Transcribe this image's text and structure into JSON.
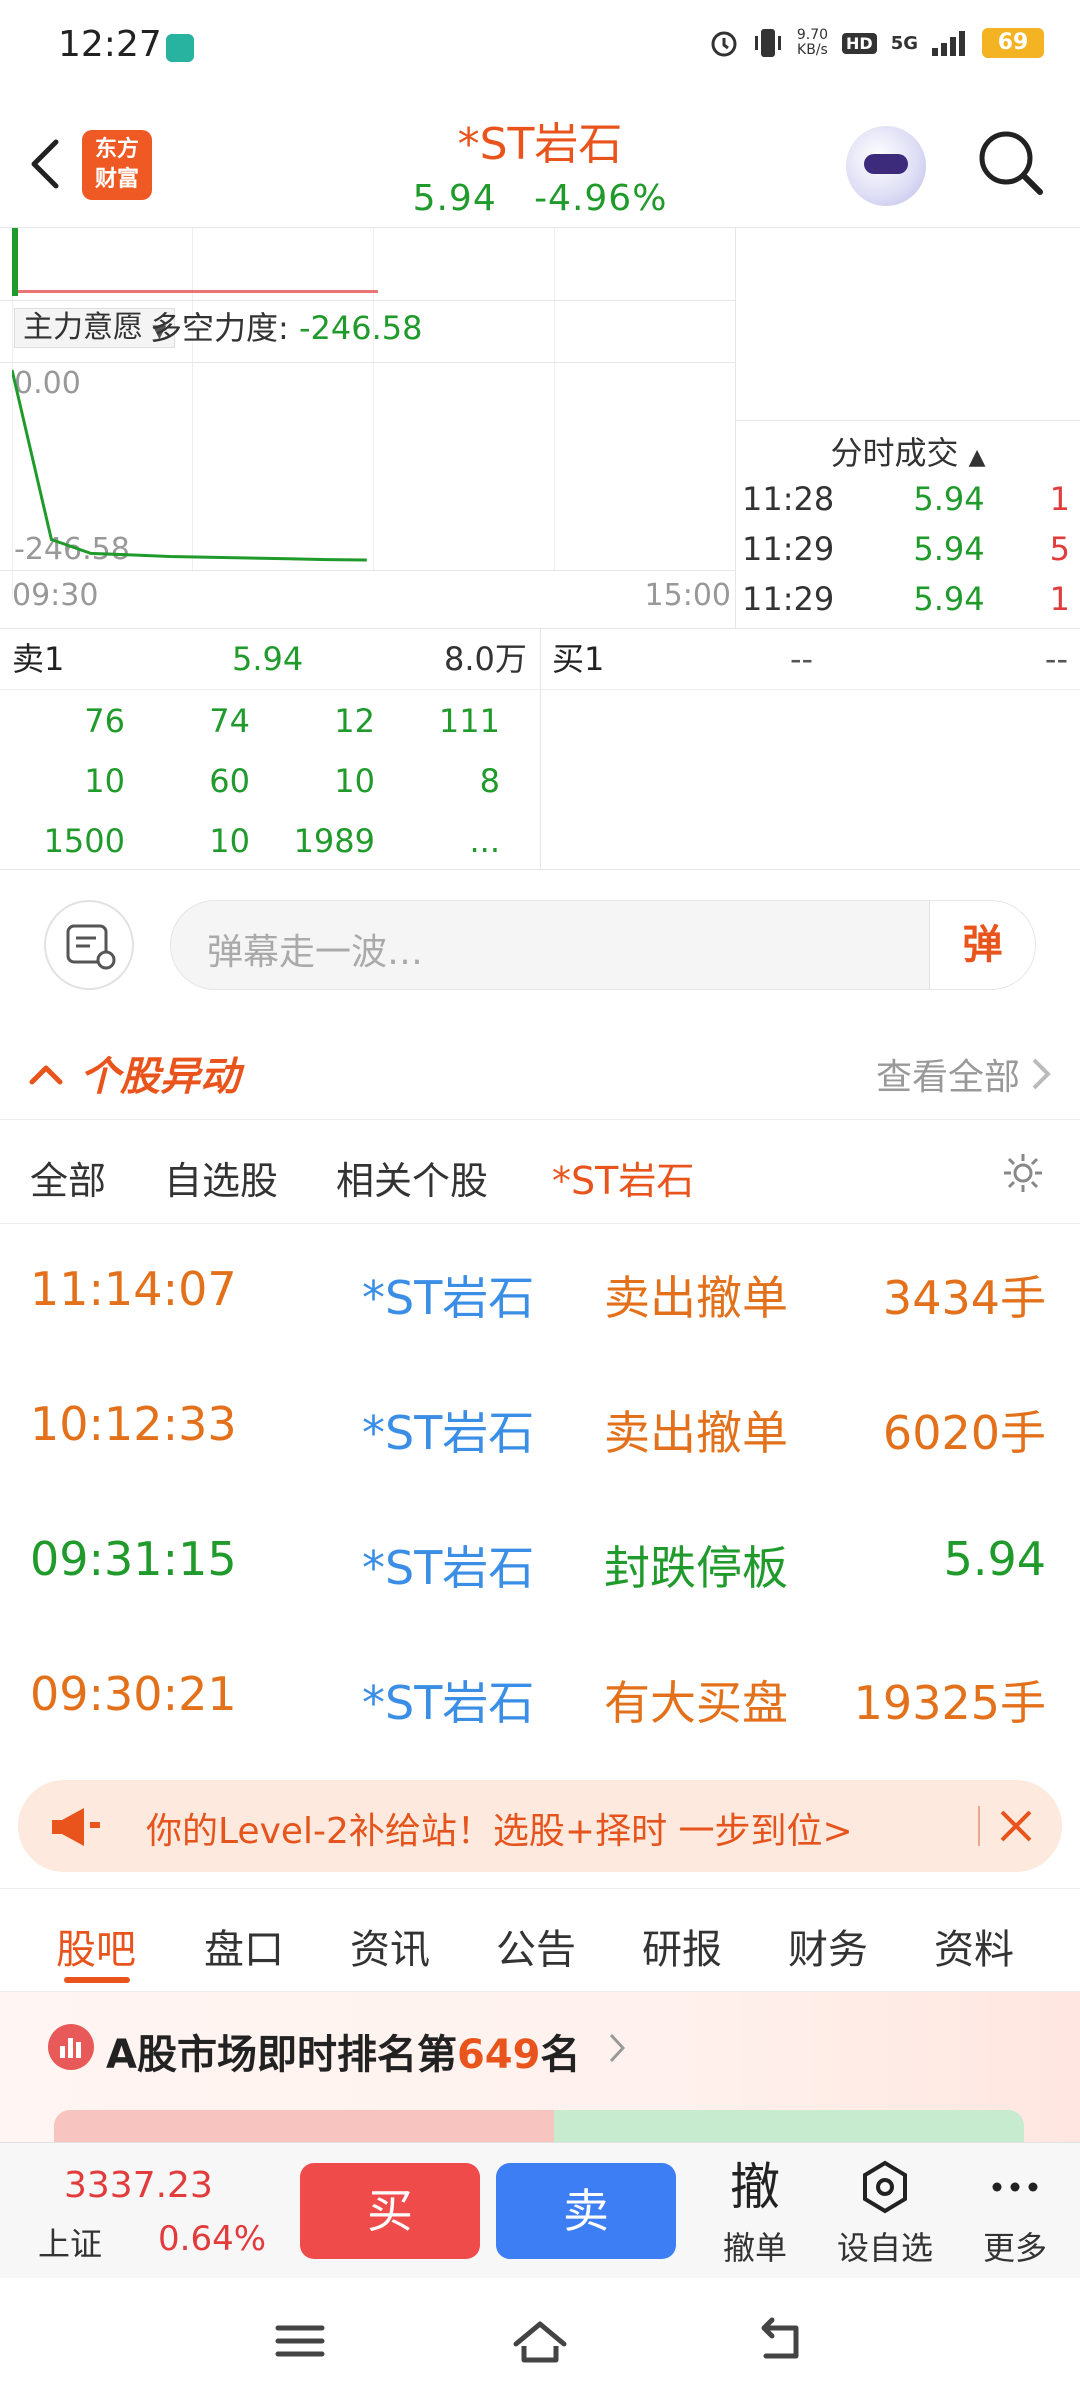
{
  "status_bar": {
    "time": "12:27",
    "net_speed": "9.70\nKB/s",
    "hd": "HD",
    "signal": "5G",
    "battery": "69"
  },
  "header": {
    "logo": "东方\n财富",
    "stock_name": "*ST岩石",
    "price": "5.94",
    "change_pct": "-4.96%"
  },
  "chart": {
    "indicator_name": "主力意愿",
    "indicator_label": "多空力度:",
    "indicator_value": "-246.58",
    "y_top": "0.00",
    "y_bottom": "-246.58",
    "x_start": "09:30",
    "x_end": "15:00",
    "indicator_series": [
      0,
      -220,
      -238,
      -240,
      -242,
      -243,
      -244,
      -245,
      -246,
      -246.58
    ]
  },
  "ticks": {
    "title": "分时成交",
    "rows": [
      {
        "time": "11:28",
        "price": "5.94",
        "vol": "1",
        "color": "#e23b3b"
      },
      {
        "time": "11:29",
        "price": "5.94",
        "vol": "5",
        "color": "#e23b3b"
      },
      {
        "time": "11:29",
        "price": "5.94",
        "vol": "1",
        "color": "#e23b3b"
      }
    ]
  },
  "order_book": {
    "sell_label": "卖1",
    "sell_price": "5.94",
    "sell_vol": "8.0万",
    "buy_label": "买1",
    "buy_price": "--",
    "buy_vol": "--",
    "queue": [
      [
        "76",
        "74",
        "12",
        "111"
      ],
      [
        "10",
        "60",
        "10",
        "8"
      ],
      [
        "1500",
        "10",
        "1989",
        "..."
      ]
    ]
  },
  "comment_bar": {
    "placeholder": "弹幕走一波…",
    "danmu": "弹"
  },
  "alerts": {
    "title": "个股异动",
    "view_all": "查看全部",
    "tabs": [
      "全部",
      "自选股",
      "相关个股",
      "*ST岩石"
    ],
    "rows": [
      {
        "time": "11:14:07",
        "stock": "*ST岩石",
        "event": "卖出撤单",
        "value": "3434手",
        "tone": "orange"
      },
      {
        "time": "10:12:33",
        "stock": "*ST岩石",
        "event": "卖出撤单",
        "value": "6020手",
        "tone": "orange"
      },
      {
        "time": "09:31:15",
        "stock": "*ST岩石",
        "event": "封跌停板",
        "value": "5.94",
        "tone": "green"
      },
      {
        "time": "09:30:21",
        "stock": "*ST岩石",
        "event": "有大买盘",
        "value": "19325手",
        "tone": "orange"
      }
    ]
  },
  "promo": {
    "text": "你的Level-2补给站！选股+择时 一步到位>"
  },
  "sub_tabs": [
    "股吧",
    "盘口",
    "资讯",
    "公告",
    "研报",
    "财务",
    "资料"
  ],
  "rank": {
    "prefix": "A股市场即时排名第",
    "number": "649",
    "suffix": "名"
  },
  "action_bar": {
    "index_value": "3337.23",
    "index_name": "上证",
    "index_pct": "0.64%",
    "buy": "买",
    "sell": "卖",
    "cancel_glyph": "撤",
    "cancel": "撤单",
    "watch": "设自选",
    "more": "更多"
  }
}
